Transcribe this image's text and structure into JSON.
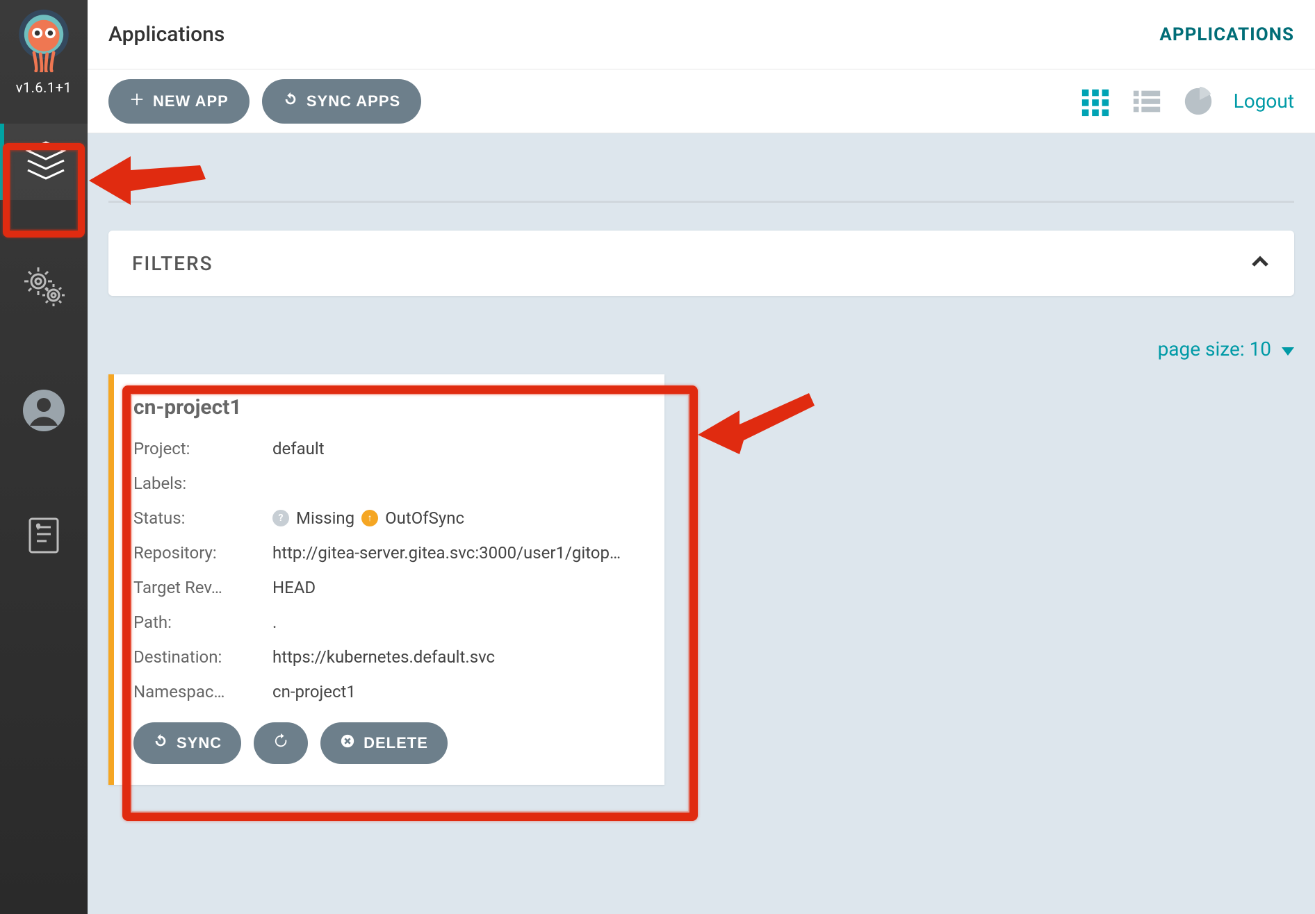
{
  "version": "v1.6.1+1",
  "topbar": {
    "title": "Applications",
    "breadcrumb": "APPLICATIONS"
  },
  "toolbar": {
    "new_app": "NEW APP",
    "sync_apps": "SYNC APPS",
    "logout": "Logout"
  },
  "filters": {
    "label": "FILTERS"
  },
  "page_size": {
    "prefix": "page size: ",
    "value": "10"
  },
  "card": {
    "name": "cn-project1",
    "rows": {
      "project": {
        "k": "Project:",
        "v": "default"
      },
      "labels": {
        "k": "Labels:",
        "v": ""
      },
      "status": {
        "k": "Status:",
        "missing": "Missing",
        "out": "OutOfSync"
      },
      "repository": {
        "k": "Repository:",
        "v": "http://gitea-server.gitea.svc:3000/user1/gitop…"
      },
      "target_rev": {
        "k": "Target Rev…",
        "v": "HEAD"
      },
      "path": {
        "k": "Path:",
        "v": "."
      },
      "destination": {
        "k": "Destination:",
        "v": "https://kubernetes.default.svc"
      },
      "namespace": {
        "k": "Namespac…",
        "v": "cn-project1"
      }
    },
    "actions": {
      "sync": "SYNC",
      "delete": "DELETE"
    }
  }
}
